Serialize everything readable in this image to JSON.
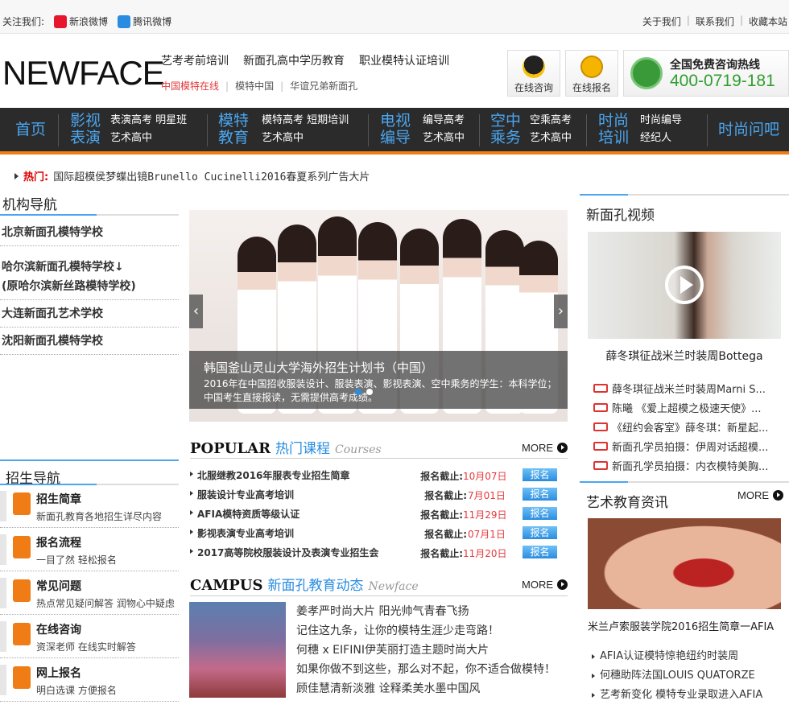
{
  "topbar": {
    "follow_label": "关注我们:",
    "weibo": "新浪微博",
    "tencent": "腾讯微博",
    "links": [
      "关于我们",
      "联系我们",
      "收藏本站"
    ]
  },
  "header": {
    "logo": "NEWFACE",
    "slogans": [
      "艺考考前培训",
      "新面孔高中学历教育",
      "职业模特认证培训"
    ],
    "sub_links": [
      "中国模特在线",
      "模特中国",
      "华谊兄弟新面孔"
    ],
    "online_consult": "在线咨询",
    "online_signup": "在线报名",
    "hotline_label": "全国免费咨询热线",
    "hotline_number": "400-0719-181"
  },
  "nav": {
    "home": "首页",
    "groups": [
      {
        "big1": "影视",
        "big2": "表演",
        "subs1": "表演高考 明星班",
        "subs2": "艺术高中"
      },
      {
        "big1": "模特",
        "big2": "教育",
        "subs1": "模特高考 短期培训",
        "subs2": "艺术高中"
      },
      {
        "big1": "电视",
        "big2": "编导",
        "subs1": "编导高考",
        "subs2": "艺术高中"
      },
      {
        "big1": "空中",
        "big2": "乘务",
        "subs1": "空乘高考",
        "subs2": "艺术高中"
      },
      {
        "big1": "时尚",
        "big2": "培训",
        "subs1": "时尚编导",
        "subs2": "经纪人"
      }
    ],
    "fashion_q": "时尚问吧"
  },
  "hot": {
    "label": "热门:",
    "text": "国际超模侯梦蝶出镜Brunello Cucinelli2016春夏系列广告大片"
  },
  "org_nav": {
    "title": "机构导航",
    "items": [
      "北京新面孔模特学校",
      "哈尔滨新面孔模特学校↓",
      "(原哈尔滨新丝路模特学校)",
      "大连新面孔艺术学校",
      "沈阳新面孔模特学校"
    ]
  },
  "enroll_nav": {
    "title": "招生导航",
    "items": [
      {
        "title": "招生简章",
        "sub": "新面孔教育各地招生详尽内容"
      },
      {
        "title": "报名流程",
        "sub": "一目了然 轻松报名"
      },
      {
        "title": "常见问题",
        "sub": "热点常见疑问解答 润物心中疑虑"
      },
      {
        "title": "在线咨询",
        "sub": "资深老师 在线实时解答"
      },
      {
        "title": "网上报名",
        "sub": "明白选课 方便报名"
      }
    ]
  },
  "banner": {
    "title": "韩国釜山灵山大学海外招生计划书（中国）",
    "desc": "2016年在中国招收服装设计、服装表演、影视表演、空中乘务的学生：本科学位；中国考生直接报读，无需提供高考成绩。"
  },
  "popular": {
    "en": "POPULAR",
    "cn": "热门课程",
    "it": "Courses",
    "more": "MORE",
    "deadline_label": "报名截止:",
    "btn": "报名",
    "rows": [
      {
        "name": "北服继教2016年服表专业招生简章",
        "date": "10月07日"
      },
      {
        "name": "服装设计专业高考培训",
        "date": "7月01日"
      },
      {
        "name": "AFIA模特资质等级认证",
        "date": "11月29日"
      },
      {
        "name": "影视表演专业高考培训",
        "date": "07月1日"
      },
      {
        "name": "2017高等院校服装设计及表演专业招生会",
        "date": "11月20日"
      }
    ]
  },
  "campus": {
    "en": "CAMPUS",
    "cn": "新面孔教育动态",
    "it": "Newface",
    "more": "MORE",
    "items": [
      "姜孝严时尚大片 阳光帅气青春飞扬",
      "记住这九条，让你的模特生涯少走弯路！",
      "何穗 x EIFINI伊芙丽打造主题时尚大片",
      "如果你做不到这些，那么对不起，你不适合做模特！",
      "顾佳慧清新淡雅 诠释柔美水墨中国风"
    ]
  },
  "video": {
    "title": "新面孔视频",
    "caption": "薛冬琪征战米兰时装周Bottega",
    "items": [
      "薛冬琪征战米兰时装周Marni S...",
      "陈曦 《爱上超模之极速天使》...",
      "《纽约会客室》薛冬琪：新星起...",
      "新面孔学员拍摄：伊周对话超模...",
      "新面孔学员拍摄：内衣模特美胸..."
    ]
  },
  "art": {
    "title": "艺术教育资讯",
    "more": "MORE",
    "caption": "米兰卢索服装学院2016招生简章一AFIA",
    "items": [
      "AFIA认证模特惊艳纽约时装周",
      "何穗助阵法国LOUIS QUATORZE",
      "艺考新变化 模特专业录取进入AFIA"
    ]
  }
}
